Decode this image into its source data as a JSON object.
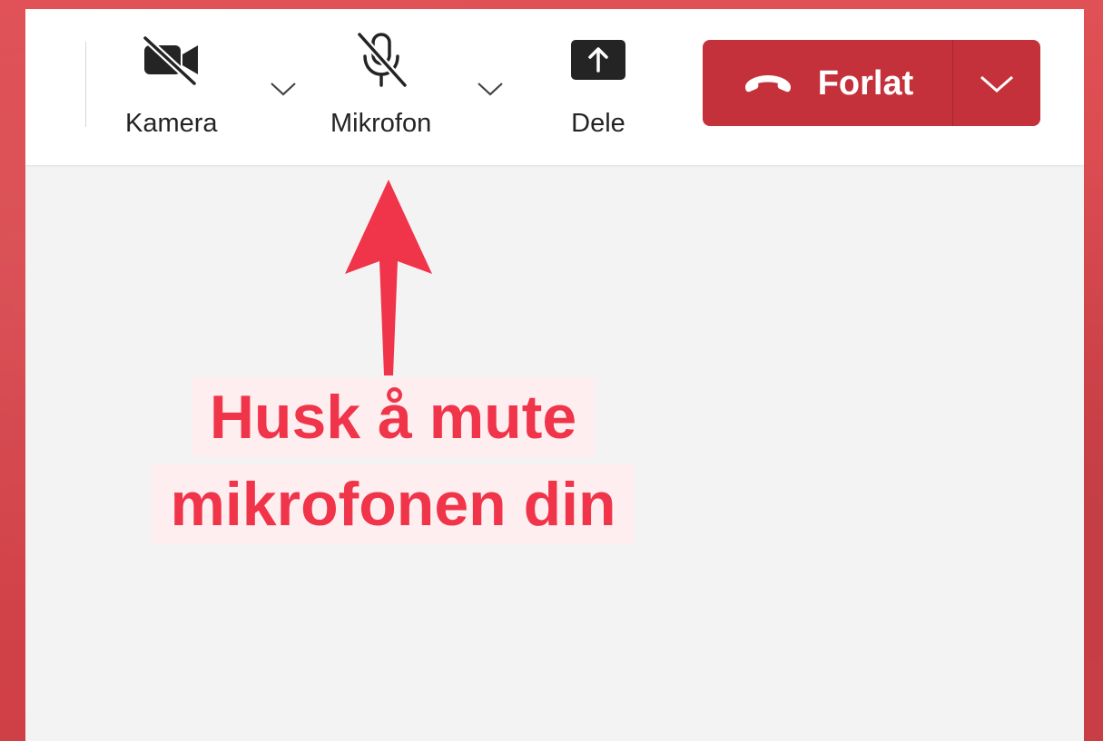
{
  "toolbar": {
    "camera_label": "Kamera",
    "microphone_label": "Mikrofon",
    "share_label": "Dele",
    "leave_label": "Forlat"
  },
  "icons": {
    "camera": "video-off-icon",
    "microphone": "mic-off-icon",
    "share": "share-screen-icon",
    "leave": "hang-up-phone-icon",
    "chevron": "chevron-down-icon"
  },
  "annotation": {
    "line1": "Husk å mute",
    "line2": "mikrofonen din"
  },
  "colors": {
    "background": "#d9474d",
    "leave_button": "#c4313b",
    "annotation_text": "#f0344a",
    "arrow": "#f0344a"
  }
}
